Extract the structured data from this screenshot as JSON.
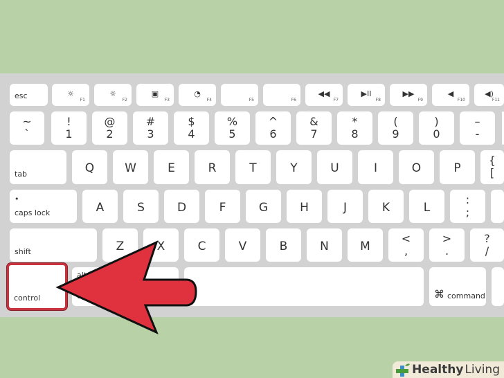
{
  "colors": {
    "background": "#b8d1a6",
    "keyboard": "#d2d2d2",
    "key": "#ffffff",
    "arrow": "#e0323e",
    "highlight": "#c7323e"
  },
  "rows": {
    "function": [
      {
        "label": "esc"
      },
      {
        "icon": "☼",
        "fn": "F1",
        "icon_name": "brightness-down-icon"
      },
      {
        "icon": "☼",
        "fn": "F2",
        "icon_name": "brightness-up-icon"
      },
      {
        "icon": "▣",
        "fn": "F3",
        "icon_name": "expose-icon"
      },
      {
        "icon": "◔",
        "fn": "F4",
        "icon_name": "dashboard-icon"
      },
      {
        "icon": "",
        "fn": "F5"
      },
      {
        "icon": "",
        "fn": "F6"
      },
      {
        "icon": "◀◀",
        "fn": "F7",
        "icon_name": "rewind-icon"
      },
      {
        "icon": "▶II",
        "fn": "F8",
        "icon_name": "play-pause-icon"
      },
      {
        "icon": "▶▶",
        "fn": "F9",
        "icon_name": "fast-forward-icon"
      },
      {
        "icon": "◀",
        "fn": "F10",
        "icon_name": "mute-icon"
      },
      {
        "icon": "◀)",
        "fn": "F11",
        "icon_name": "volume-icon"
      }
    ],
    "number": [
      [
        "~",
        "`"
      ],
      [
        "!",
        "1"
      ],
      [
        "@",
        "2"
      ],
      [
        "#",
        "3"
      ],
      [
        "$",
        "4"
      ],
      [
        "%",
        "5"
      ],
      [
        "^",
        "6"
      ],
      [
        "&",
        "7"
      ],
      [
        "*",
        "8"
      ],
      [
        "(",
        "9"
      ],
      [
        ")",
        "0"
      ],
      [
        "–",
        "-"
      ]
    ],
    "qwerty": {
      "modifier": "tab",
      "keys": [
        "Q",
        "W",
        "E",
        "R",
        "T",
        "Y",
        "U",
        "I",
        "O",
        "P"
      ],
      "extra": [
        "{",
        "["
      ]
    },
    "home": {
      "modifier": "caps lock",
      "modifier_dot": "•",
      "keys": [
        "A",
        "S",
        "D",
        "F",
        "G",
        "H",
        "J",
        "K",
        "L"
      ],
      "extra": [
        ":",
        ";"
      ]
    },
    "shift": {
      "modifier": "shift",
      "keys": [
        "Z",
        "X",
        "C",
        "V",
        "B",
        "N",
        "M"
      ],
      "extra": [
        [
          "<",
          ","
        ],
        [
          ">",
          "."
        ],
        [
          "?",
          "/"
        ]
      ]
    },
    "bottom": {
      "control": "control",
      "alt": "alt",
      "option": "option",
      "command_symbol": "⌘",
      "command": "command"
    }
  },
  "watermark": {
    "bold": "Healthy",
    "light": "Living"
  }
}
